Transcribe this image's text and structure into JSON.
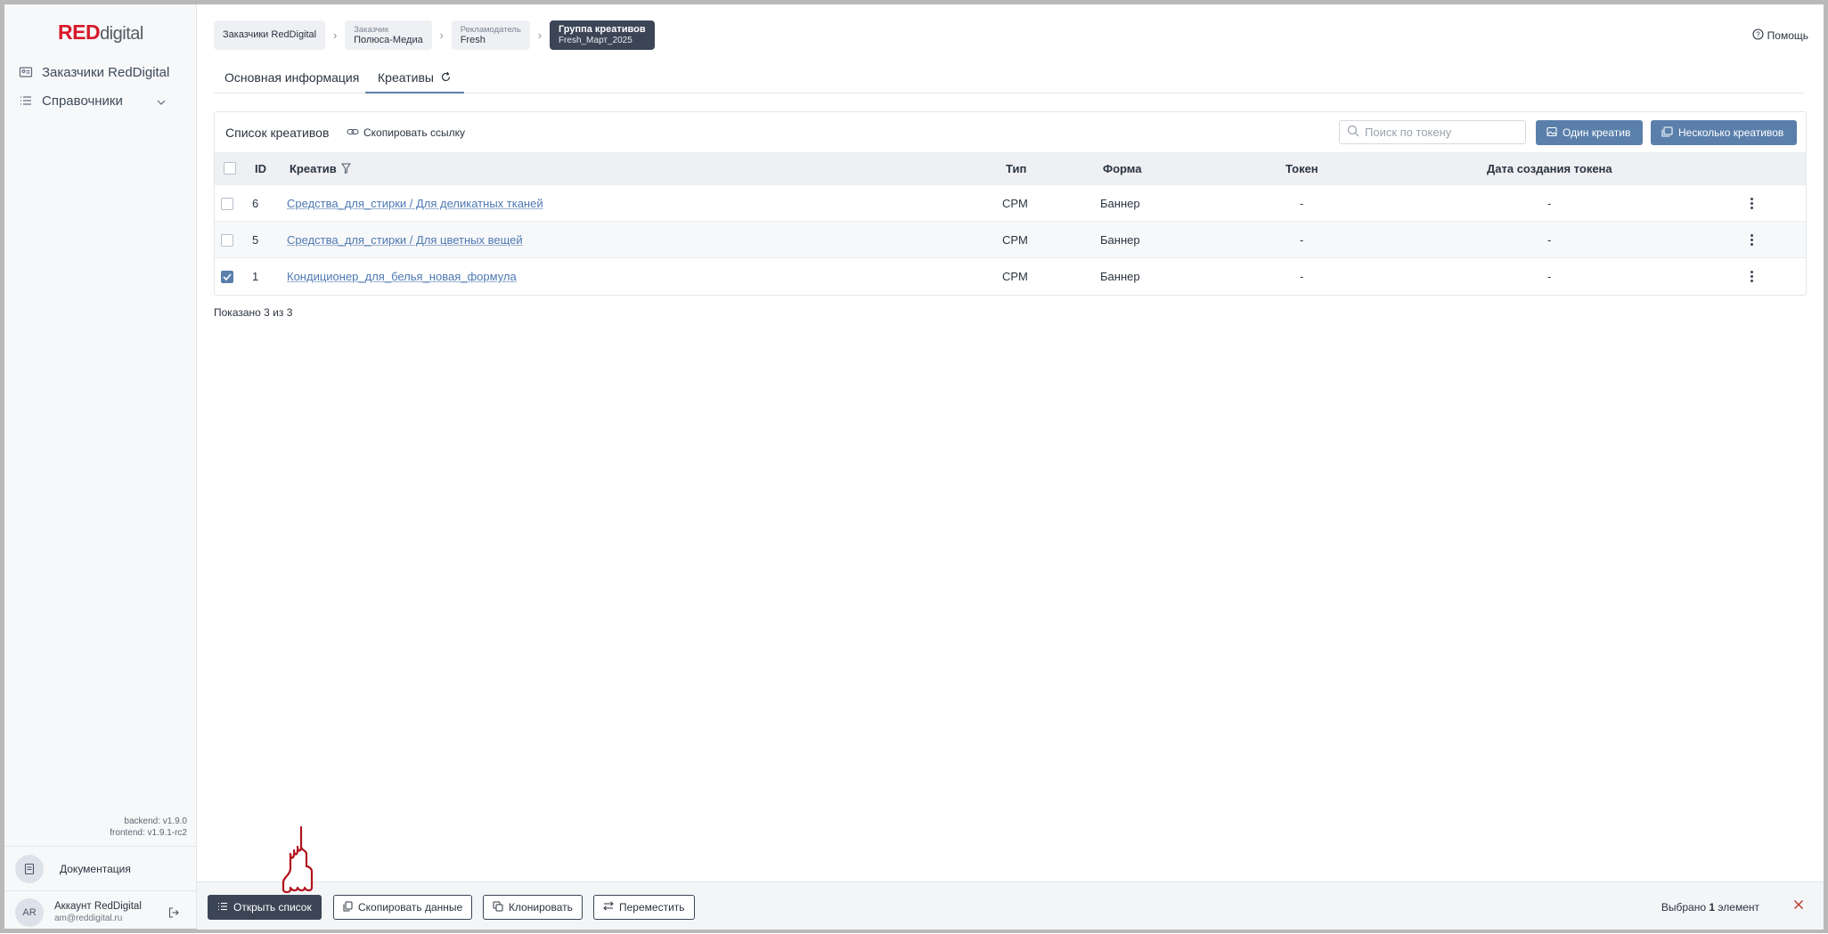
{
  "brand": {
    "red": "RED",
    "rest": "digital"
  },
  "sidebar": {
    "items": [
      {
        "label": "Заказчики RedDigital",
        "icon": "id-card-icon"
      },
      {
        "label": "Справочники",
        "icon": "list-icon"
      }
    ],
    "backend_version": "backend: v1.9.0",
    "frontend_version": "frontend: v1.9.1-rc2",
    "docs_label": "Документация",
    "account": {
      "initials": "AR",
      "name": "Аккаунт RedDigital",
      "email": "am@reddigital.ru"
    }
  },
  "breadcrumbs": [
    {
      "title": "",
      "value": "Заказчики RedDigital"
    },
    {
      "title": "Заказчик",
      "value": "Полюса-Медиа"
    },
    {
      "title": "Рекламодатель",
      "value": "Fresh"
    },
    {
      "title": "Группа креативов",
      "value": "Fresh_Март_2025"
    }
  ],
  "help_label": "Помощь",
  "tabs": [
    {
      "label": "Основная информация"
    },
    {
      "label": "Креативы"
    }
  ],
  "panel": {
    "title": "Список креативов",
    "copy_link_label": "Скопировать ссылку",
    "search_placeholder": "Поиск по токену",
    "btn_one": "Один креатив",
    "btn_many": "Несколько креативов"
  },
  "table": {
    "columns": {
      "id": "ID",
      "creative": "Креатив",
      "type": "Тип",
      "form": "Форма",
      "token": "Токен",
      "token_date": "Дата создания токена"
    },
    "rows": [
      {
        "id": "6",
        "creative": "Средства_для_стирки / Для деликатных тканей",
        "type": "CPM",
        "form": "Баннер",
        "token": "-",
        "token_date": "-",
        "checked": false
      },
      {
        "id": "5",
        "creative": "Средства_для_стирки / Для цветных вещей",
        "type": "CPM",
        "form": "Баннер",
        "token": "-",
        "token_date": "-",
        "checked": false
      },
      {
        "id": "1",
        "creative": "Кондиционер_для_белья_новая_формула",
        "type": "CPM",
        "form": "Баннер",
        "token": "-",
        "token_date": "-",
        "checked": true
      }
    ]
  },
  "shown_count": "Показано 3 из 3",
  "bottom_bar": {
    "open_list": "Открыть список",
    "copy_data": "Скопировать данные",
    "clone": "Клонировать",
    "move": "Переместить",
    "selected_prefix": "Выбрано",
    "selected_count": "1",
    "selected_suffix": "элемент"
  },
  "colors": {
    "accent": "#5a7fab",
    "dark": "#3b4556",
    "brand_red": "#d8182a"
  }
}
